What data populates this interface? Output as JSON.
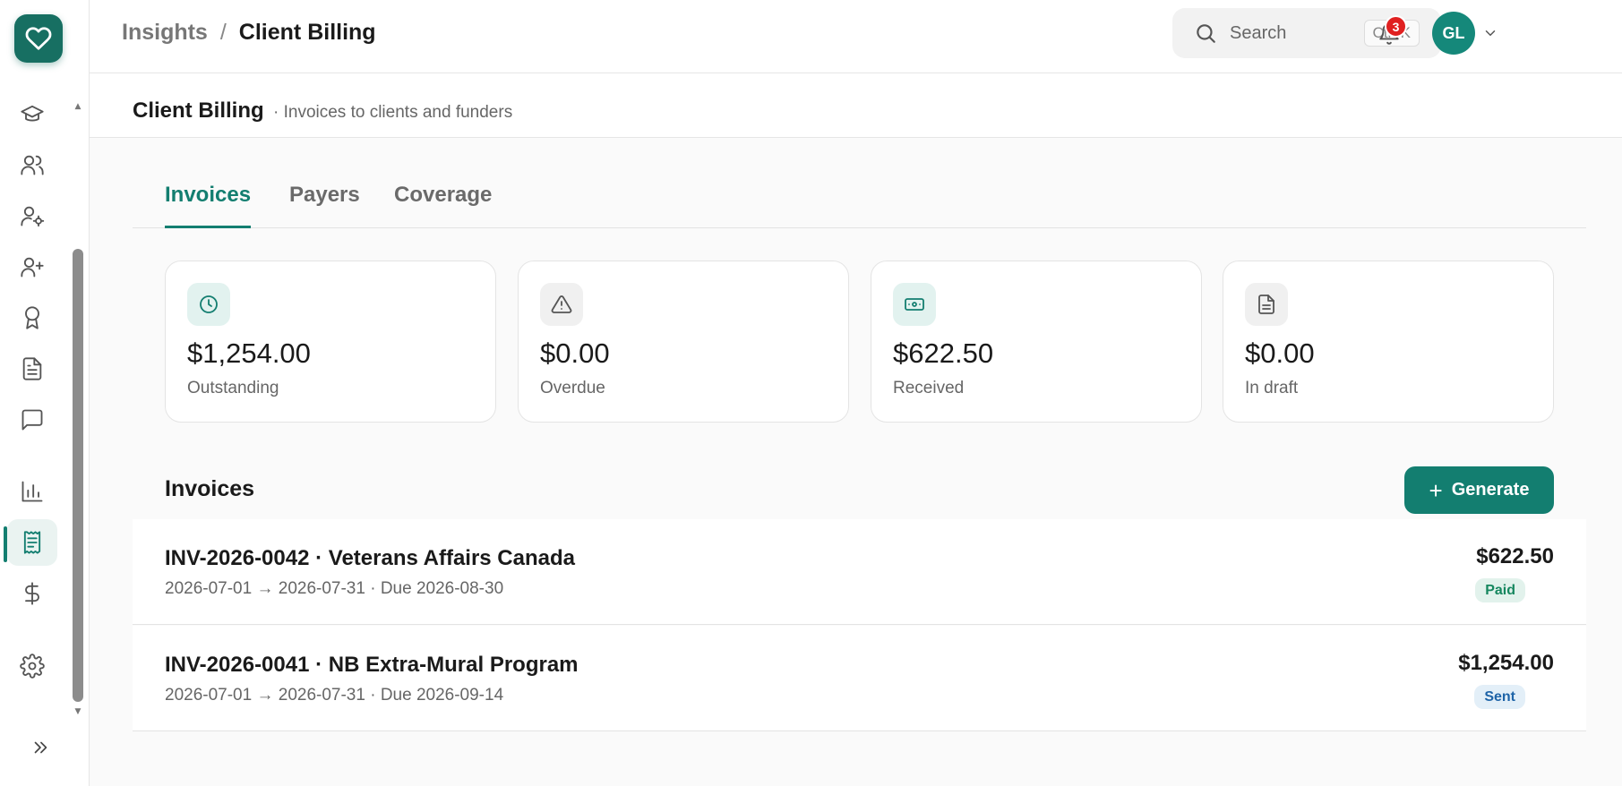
{
  "breadcrumb": {
    "parent": "Insights",
    "separator": "/",
    "current": "Client Billing"
  },
  "search": {
    "label": "Search",
    "shortcut": "Ctrl K"
  },
  "notifications": {
    "count": "3"
  },
  "user": {
    "initials": "GL"
  },
  "page": {
    "title": "Client Billing",
    "subtitle": "· Invoices to clients and funders"
  },
  "sidebar": {
    "items": [
      {
        "name": "training",
        "icon": "graduation-cap-icon"
      },
      {
        "name": "clients",
        "icon": "users-icon"
      },
      {
        "name": "staff-settings",
        "icon": "user-cog-icon"
      },
      {
        "name": "add-user",
        "icon": "user-plus-icon"
      },
      {
        "name": "certifications",
        "icon": "award-icon"
      },
      {
        "name": "documents",
        "icon": "file-text-icon"
      },
      {
        "name": "messages",
        "icon": "message-square-icon"
      },
      {
        "name": "reports",
        "icon": "bar-chart-icon"
      },
      {
        "name": "billing",
        "icon": "receipt-icon",
        "active": true
      },
      {
        "name": "payroll",
        "icon": "dollar-sign-icon"
      },
      {
        "name": "settings",
        "icon": "gear-icon"
      }
    ]
  },
  "tabs": [
    {
      "label": "Invoices",
      "active": true
    },
    {
      "label": "Payers",
      "active": false
    },
    {
      "label": "Coverage",
      "active": false
    }
  ],
  "stats": [
    {
      "value": "$1,254.00",
      "label": "Outstanding",
      "icon": "clock-icon"
    },
    {
      "value": "$0.00",
      "label": "Overdue",
      "icon": "alert-triangle-icon"
    },
    {
      "value": "$622.50",
      "label": "Received",
      "icon": "banknote-icon"
    },
    {
      "value": "$0.00",
      "label": "In draft",
      "icon": "file-icon"
    }
  ],
  "invoices_section": {
    "title": "Invoices",
    "generate_label": "Generate"
  },
  "invoices": [
    {
      "title": "INV-2026-0042 · Veterans Affairs Canada",
      "period": "2026-07-01 → 2026-07-31 · Due 2026-08-30",
      "amount": "$622.50",
      "status": "Paid"
    },
    {
      "title": "INV-2026-0041 · NB Extra-Mural Program",
      "period": "2026-07-01 → 2026-07-31 · Due 2026-09-14",
      "amount": "$1,254.00",
      "status": "Sent"
    }
  ],
  "colors": {
    "accent": "#137e70",
    "logo": "#176f62",
    "paid": "#16875f",
    "sent": "#1e64a8",
    "badge": "#e02020"
  }
}
